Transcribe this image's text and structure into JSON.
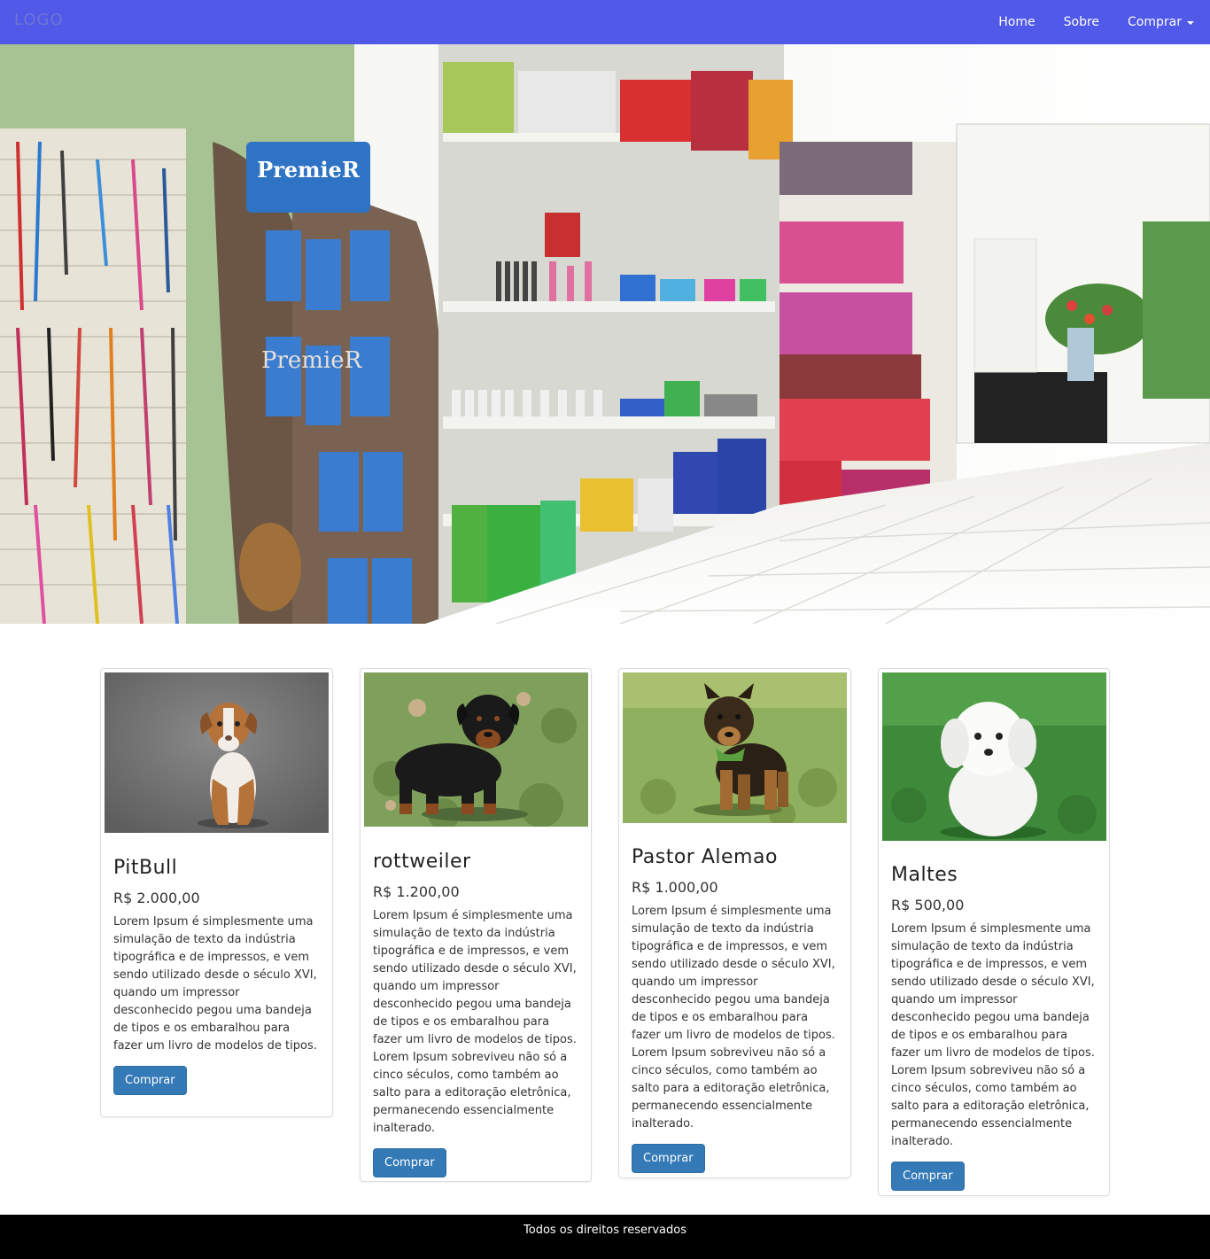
{
  "navbar": {
    "logo": "LOGO",
    "links": [
      {
        "label": "Home"
      },
      {
        "label": "Sobre"
      },
      {
        "label": "Comprar"
      }
    ]
  },
  "hero": {
    "alt": "pet shop interior"
  },
  "products": [
    {
      "title": "PitBull",
      "price": "R$ 2.000,00",
      "description": "Lorem Ipsum é simplesmente uma simulação de texto da indústria tipográfica e de impressos, e vem sendo utilizado desde o século XVI, quando um impressor desconhecido pegou uma bandeja de tipos e os embaralhou para fazer um livro de modelos de tipos.",
      "button": "Comprar"
    },
    {
      "title": "rottweiler",
      "price": "R$ 1.200,00",
      "description": "Lorem Ipsum é simplesmente uma simulação de texto da indústria tipográfica e de impressos, e vem sendo utilizado desde o século XVI, quando um impressor desconhecido pegou uma bandeja de tipos e os embaralhou para fazer um livro de modelos de tipos. Lorem Ipsum sobreviveu não só a cinco séculos, como também ao salto para a editoração eletrônica, permanecendo essencialmente inalterado.",
      "button": "Comprar"
    },
    {
      "title": "Pastor Alemao",
      "price": "R$ 1.000,00",
      "description": "Lorem Ipsum é simplesmente uma simulação de texto da indústria tipográfica e de impressos, e vem sendo utilizado desde o século XVI, quando um impressor desconhecido pegou uma bandeja de tipos e os embaralhou para fazer um livro de modelos de tipos. Lorem Ipsum sobreviveu não só a cinco séculos, como também ao salto para a editoração eletrônica, permanecendo essencialmente inalterado.",
      "button": "Comprar"
    },
    {
      "title": "Maltes",
      "price": "R$ 500,00",
      "description": "Lorem Ipsum é simplesmente uma simulação de texto da indústria tipográfica e de impressos, e vem sendo utilizado desde o século XVI, quando um impressor desconhecido pegou uma bandeja de tipos e os embaralhou para fazer um livro de modelos de tipos. Lorem Ipsum sobreviveu não só a cinco séculos, como também ao salto para a editoração eletrônica, permanecendo essencialmente inalterado.",
      "button": "Comprar"
    }
  ],
  "footer": {
    "text": "Todos os direitos reservados"
  },
  "colors": {
    "navbar": "#5059e8",
    "button": "#337ab7",
    "footer": "#000000"
  }
}
